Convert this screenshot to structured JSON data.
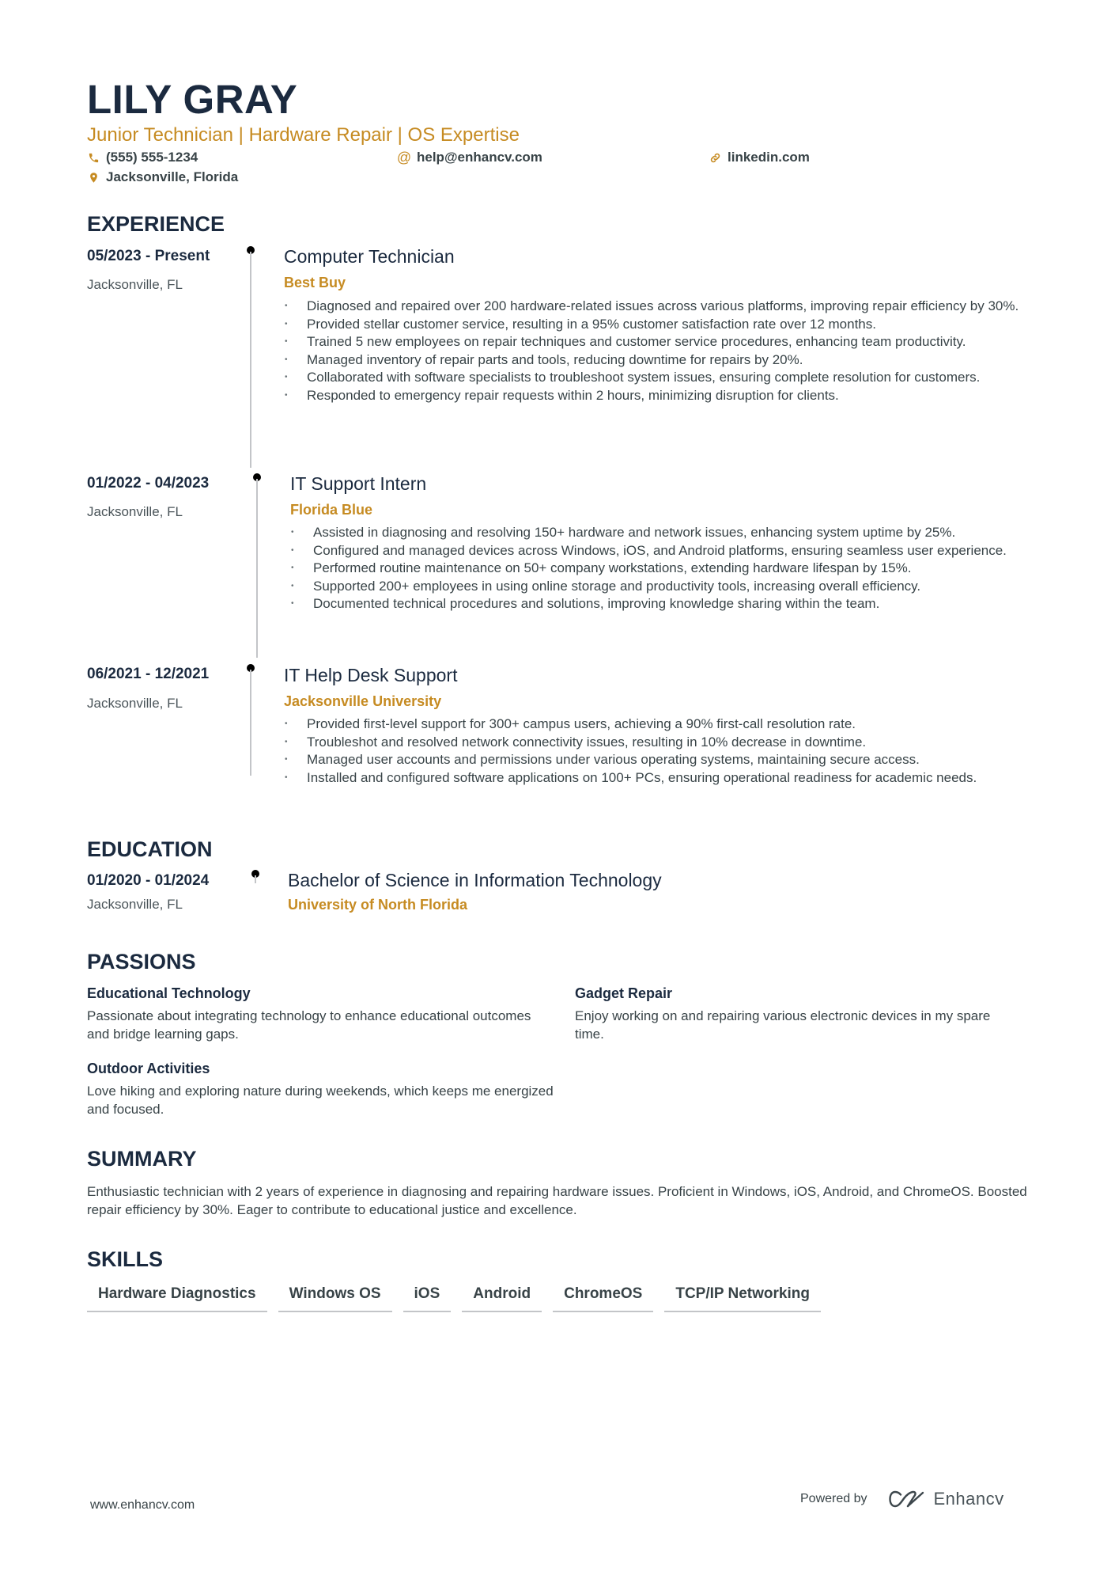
{
  "header": {
    "name": "LILY GRAY",
    "tagline": "Junior Technician | Hardware Repair | OS Expertise",
    "phone": "(555) 555-1234",
    "email": "help@enhancv.com",
    "linkedin": "linkedin.com",
    "location": "Jacksonville, Florida",
    "icons": {
      "phone": "phone-icon",
      "email": "at-icon",
      "linkedin": "link-icon",
      "location": "map-pin-icon"
    },
    "accent_color": "#c68b22",
    "name_color": "#1b2a3f"
  },
  "experience": {
    "title": "EXPERIENCE",
    "entries": [
      {
        "dates": "05/2023 - Present",
        "location": "Jacksonville, FL",
        "role": "Computer Technician",
        "company": "Best Buy",
        "bullets": [
          "Diagnosed and repaired over 200 hardware-related issues across various platforms, improving repair efficiency by 30%.",
          "Provided stellar customer service, resulting in a 95% customer satisfaction rate over 12 months.",
          "Trained 5 new employees on repair techniques and customer service procedures, enhancing team productivity.",
          "Managed inventory of repair parts and tools, reducing downtime for repairs by 20%.",
          "Collaborated with software specialists to troubleshoot system issues, ensuring complete resolution for customers.",
          "Responded to emergency repair requests within 2 hours, minimizing disruption for clients."
        ]
      },
      {
        "dates": "01/2022 - 04/2023",
        "location": "Jacksonville, FL",
        "role": "IT Support Intern",
        "company": "Florida Blue",
        "bullets": [
          "Assisted in diagnosing and resolving 150+ hardware and network issues, enhancing system uptime by 25%.",
          "Configured and managed devices across Windows, iOS, and Android platforms, ensuring seamless user experience.",
          "Performed routine maintenance on 50+ company workstations, extending hardware lifespan by 15%.",
          "Supported 200+ employees in using online storage and productivity tools, increasing overall efficiency.",
          "Documented technical procedures and solutions, improving knowledge sharing within the team."
        ]
      },
      {
        "dates": "06/2021 - 12/2021",
        "location": "Jacksonville, FL",
        "role": "IT Help Desk Support",
        "company": "Jacksonville University",
        "bullets": [
          "Provided first-level support for 300+ campus users, achieving a 90% first-call resolution rate.",
          "Troubleshot and resolved network connectivity issues, resulting in 10% decrease in downtime.",
          "Managed user accounts and permissions under various operating systems, maintaining secure access.",
          "Installed and configured software applications on 100+ PCs, ensuring operational readiness for academic needs."
        ]
      }
    ]
  },
  "education": {
    "title": "EDUCATION",
    "entries": [
      {
        "dates": "01/2020 - 01/2024",
        "location": "Jacksonville, FL",
        "degree": "Bachelor of Science in Information Technology",
        "school": "University of North Florida"
      }
    ]
  },
  "passions": {
    "title": "PASSIONS",
    "items": [
      {
        "title": "Educational Technology",
        "description": "Passionate about integrating technology to enhance educational outcomes and bridge learning gaps."
      },
      {
        "title": "Gadget Repair",
        "description": "Enjoy working on and repairing various electronic devices in my spare time."
      },
      {
        "title": "Outdoor Activities",
        "description": "Love hiking and exploring nature during weekends, which keeps me energized and focused."
      }
    ]
  },
  "summary": {
    "title": "SUMMARY",
    "text": "Enthusiastic technician with 2 years of experience in diagnosing and repairing hardware issues. Proficient in Windows, iOS, Android, and ChromeOS. Boosted repair efficiency by 30%. Eager to contribute to educational justice and excellence."
  },
  "skills": {
    "title": "SKILLS",
    "items": [
      "Hardware Diagnostics",
      "Windows OS",
      "iOS",
      "Android",
      "ChromeOS",
      "TCP/IP Networking"
    ]
  },
  "footer": {
    "website": "www.enhancv.com",
    "powered_by": "Powered by",
    "brand": "Enhancv",
    "brand_icon": "enhancv-logo-icon"
  }
}
